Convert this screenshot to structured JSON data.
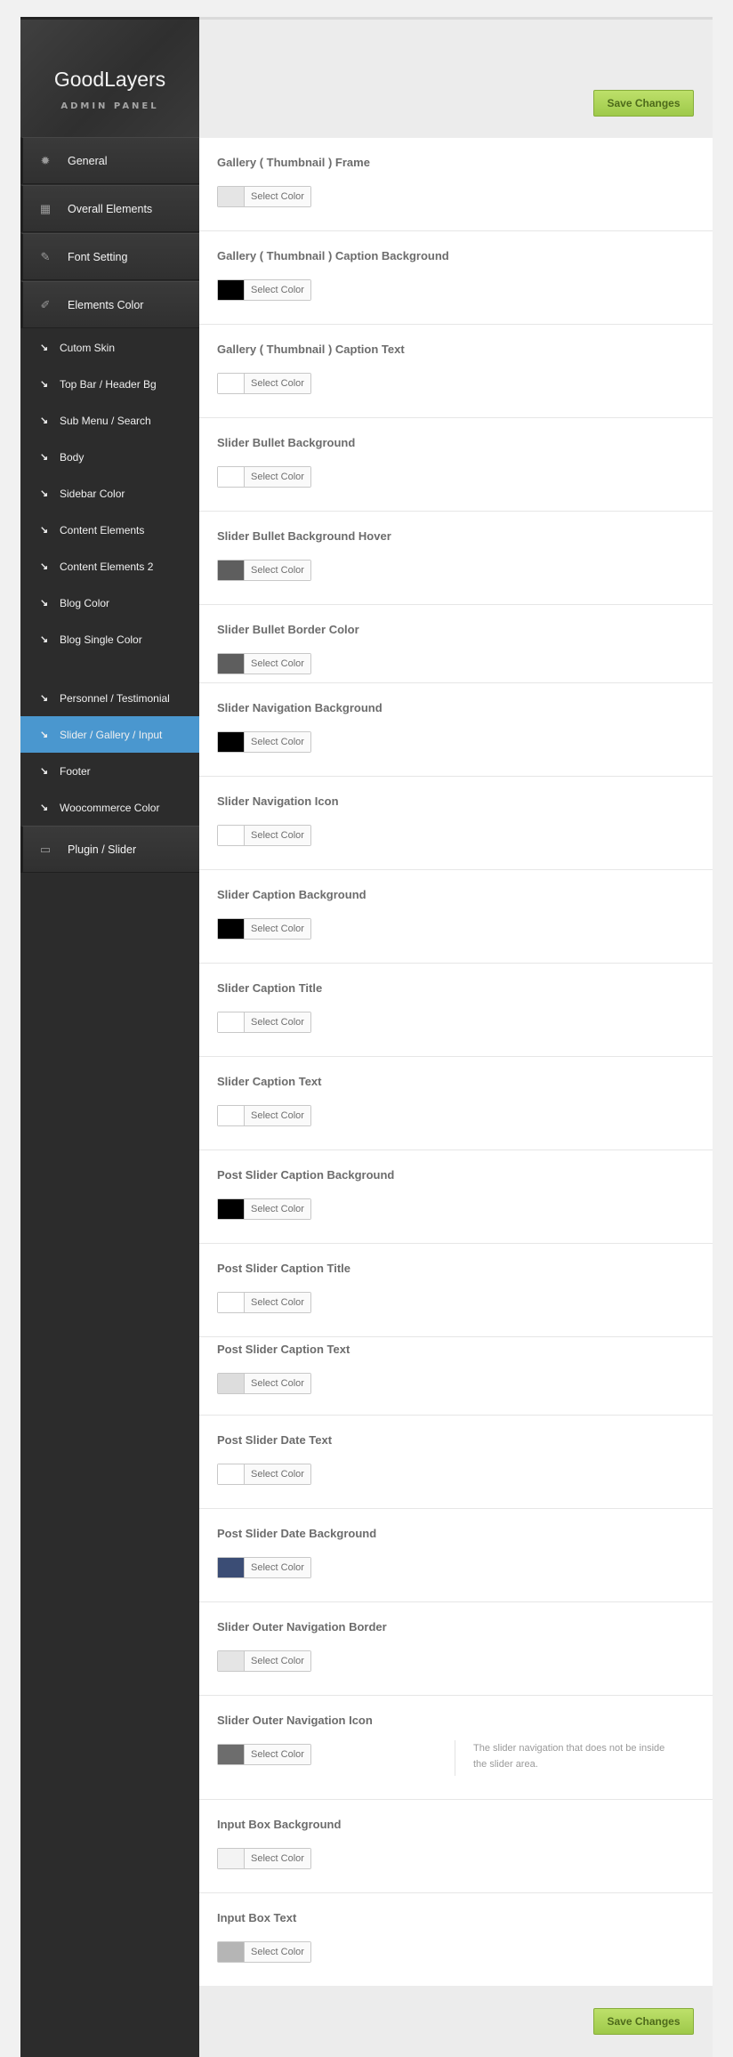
{
  "brand": {
    "title": "GoodLayers",
    "subtitle": "ADMIN PANEL"
  },
  "save_label": "Save Changes",
  "main_menu": [
    {
      "label": "General",
      "icon": "gear-icon"
    },
    {
      "label": "Overall Elements",
      "icon": "layout-icon"
    },
    {
      "label": "Font Setting",
      "icon": "pencil-icon"
    },
    {
      "label": "Elements Color",
      "icon": "brush-icon"
    },
    {
      "label": "Plugin / Slider",
      "icon": "slides-icon"
    }
  ],
  "sub_menu": [
    "Cutom Skin",
    "Top Bar / Header Bg",
    "Sub Menu / Search",
    "Body",
    "Sidebar Color",
    "Content Elements",
    "Content Elements 2",
    "Blog Color",
    "Blog Single Color",
    "Personnel / Testimonial",
    "Slider / Gallery / Input",
    "Footer",
    "Woocommerce Color"
  ],
  "active_sub": "Slider / Gallery / Input",
  "picker_label": "Select Color",
  "settings": [
    {
      "title": "Gallery ( Thumbnail ) Frame",
      "color": "#e5e5e5"
    },
    {
      "title": "Gallery ( Thumbnail ) Caption Background",
      "color": "#000000"
    },
    {
      "title": "Gallery ( Thumbnail ) Caption Text",
      "color": "#ffffff"
    },
    {
      "title": "Slider Bullet Background",
      "color": "#ffffff"
    },
    {
      "title": "Slider Bullet Background Hover",
      "color": "#5e5e5e"
    },
    {
      "title": "Slider Bullet Border Color",
      "color": "#5e5e5e"
    },
    {
      "title": "Slider Navigation Background",
      "color": "#000000"
    },
    {
      "title": "Slider Navigation Icon",
      "color": "#ffffff"
    },
    {
      "title": "Slider Caption Background",
      "color": "#000000"
    },
    {
      "title": "Slider Caption Title",
      "color": "#ffffff"
    },
    {
      "title": "Slider Caption Text",
      "color": "#ffffff"
    },
    {
      "title": "Post Slider Caption Background",
      "color": "#000000"
    },
    {
      "title": "Post Slider Caption Title",
      "color": "#ffffff"
    },
    {
      "title": "Post Slider Caption Text",
      "color": "#dddddd"
    },
    {
      "title": "Post Slider Date Text",
      "color": "#ffffff"
    },
    {
      "title": "Post Slider Date Background",
      "color": "#3b4d75"
    },
    {
      "title": "Slider Outer Navigation Border",
      "color": "#e5e5e5"
    },
    {
      "title": "Slider Outer Navigation Icon",
      "color": "#6d6d6d",
      "description": "The slider navigation that does not be inside the slider area."
    },
    {
      "title": "Input Box Background",
      "color": "#f3f3f3"
    },
    {
      "title": "Input Box Text",
      "color": "#b5b5b5"
    }
  ]
}
